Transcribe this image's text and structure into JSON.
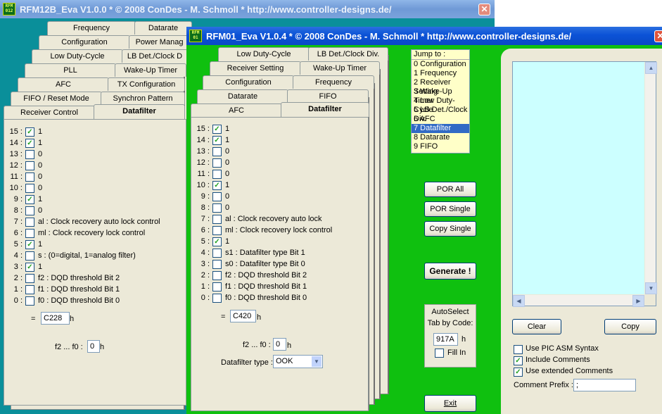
{
  "back_window": {
    "title": "RFM12B_Eva V1.0.0 * © 2008 ConDes - M. Schmoll * http://www.controller-designs.de/",
    "close": "✕",
    "tabs_row1": [
      "Frequency",
      "Datarate"
    ],
    "tabs_row2": [
      "Configuration",
      "Power Manag"
    ],
    "tabs_row3": [
      "Low Duty-Cycle",
      "LB Det./Clock D"
    ],
    "tabs_row4": [
      "PLL",
      "Wake-Up Timer"
    ],
    "tabs_row5": [
      "AFC",
      "TX Configuration"
    ],
    "tabs_row6": [
      "FIFO / Reset Mode",
      "Synchron Pattern"
    ],
    "tabs_row7": [
      "Receiver Control",
      "Datafilter"
    ],
    "rows": [
      {
        "num": "15 :",
        "checked": true,
        "label": "1"
      },
      {
        "num": "14 :",
        "checked": true,
        "label": "1"
      },
      {
        "num": "13 :",
        "checked": false,
        "label": "0"
      },
      {
        "num": "12 :",
        "checked": false,
        "label": "0"
      },
      {
        "num": "11 :",
        "checked": false,
        "label": "0"
      },
      {
        "num": "10 :",
        "checked": false,
        "label": "0"
      },
      {
        "num": "9 :",
        "checked": true,
        "label": "1"
      },
      {
        "num": "8 :",
        "checked": false,
        "label": "0"
      },
      {
        "num": "7 :",
        "checked": false,
        "label": "al : Clock recovery auto lock control"
      },
      {
        "num": "6 :",
        "checked": false,
        "label": "ml : Clock recovery lock control"
      },
      {
        "num": "5 :",
        "checked": true,
        "label": "1"
      },
      {
        "num": "4 :",
        "checked": false,
        "label": "s : (0=digital, 1=analog filter)"
      },
      {
        "num": "3 :",
        "checked": true,
        "label": "1"
      },
      {
        "num": "2 :",
        "checked": false,
        "label": "f2 : DQD threshold Bit 2"
      },
      {
        "num": "1 :",
        "checked": false,
        "label": "f1 : DQD threshold Bit 1"
      },
      {
        "num": "0 :",
        "checked": false,
        "label": "f0 : DQD threshold Bit 0"
      }
    ],
    "eq_label": "=",
    "hex_value": "C228",
    "h": "h",
    "f_label": "f2 ... f0 :",
    "f_value": "0"
  },
  "front_window": {
    "title": "RFM01_Eva V1.0.4 * © 2008 ConDes - M. Schmoll * http://www.controller-designs.de/",
    "close": "✕",
    "tabs_row1": [
      "Low Duty-Cycle",
      "LB Det./Clock Div."
    ],
    "tabs_row2": [
      "Receiver Setting",
      "Wake-Up Timer"
    ],
    "tabs_row3": [
      "Configuration",
      "Frequency"
    ],
    "tabs_row4": [
      "Datarate",
      "FIFO"
    ],
    "tabs_row5": [
      "AFC",
      "Datafilter"
    ],
    "rows": [
      {
        "num": "15 :",
        "checked": true,
        "label": "1"
      },
      {
        "num": "14 :",
        "checked": true,
        "label": "1"
      },
      {
        "num": "13 :",
        "checked": false,
        "label": "0"
      },
      {
        "num": "12 :",
        "checked": false,
        "label": "0"
      },
      {
        "num": "11 :",
        "checked": false,
        "label": "0"
      },
      {
        "num": "10 :",
        "checked": true,
        "label": "1"
      },
      {
        "num": "9 :",
        "checked": false,
        "label": "0"
      },
      {
        "num": "8 :",
        "checked": false,
        "label": "0"
      },
      {
        "num": "7 :",
        "checked": false,
        "label": "al : Clock recovery auto lock"
      },
      {
        "num": "6 :",
        "checked": false,
        "label": "ml : Clock recovery lock control"
      },
      {
        "num": "5 :",
        "checked": true,
        "label": "1"
      },
      {
        "num": "4 :",
        "checked": false,
        "label": "s1 : Datafilter type Bit 1"
      },
      {
        "num": "3 :",
        "checked": false,
        "label": "s0 : Datafilter type Bit 0"
      },
      {
        "num": "2 :",
        "checked": false,
        "label": "f2 : DQD threshold Bit 2"
      },
      {
        "num": "1 :",
        "checked": false,
        "label": "f1 : DQD threshold Bit 1"
      },
      {
        "num": "0 :",
        "checked": false,
        "label": "f0 : DQD threshold Bit 0"
      }
    ],
    "eq_label": "=",
    "hex_value": "C420",
    "h": "h",
    "f_label": "f2 ... f0 :",
    "f_value": "0",
    "datafilter_label": "Datafilter type :",
    "datafilter_value": "OOK",
    "jump_label": "Jump to :",
    "jump_items": [
      "0 Configuration",
      "1 Frequency",
      "2 Receiver Setting",
      "3 Wake-Up Timer",
      "4 Low Duty-Cycle",
      "5 LB Det./Clock Div.",
      "6 AFC",
      "7 Datafilter",
      "8 Datarate",
      "9 FIFO"
    ],
    "jump_selected": "7 Datafilter",
    "por_all": "POR All",
    "por_single": "POR Single",
    "copy_single": "Copy Single",
    "generate": "Generate !",
    "autoselect_line1": "AutoSelect",
    "autoselect_line2": "Tab by Code:",
    "autoselect_value": "917A",
    "fill_in": "Fill In",
    "exit": "Exit",
    "clear": "Clear",
    "copy": "Copy",
    "opt_pic": "Use PIC ASM Syntax",
    "opt_comments": "Include Comments",
    "opt_extended": "Use extended Comments",
    "opt_pic_checked": false,
    "opt_comments_checked": true,
    "opt_extended_checked": true,
    "comment_prefix_label": "Comment Prefix :",
    "comment_prefix_value": ";",
    "output_bg": "#ccffff"
  }
}
